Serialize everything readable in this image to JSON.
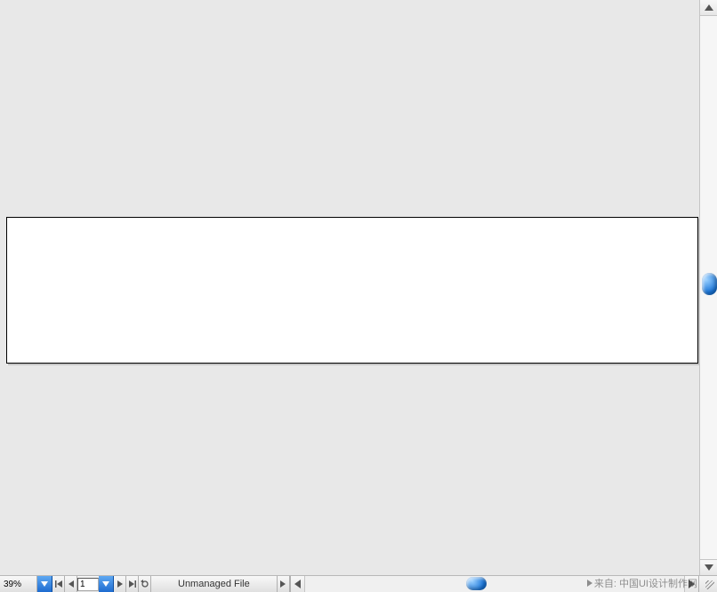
{
  "viewport": {
    "zoom": "39%"
  },
  "pagination": {
    "current_page": "1"
  },
  "status": {
    "file_state": "Unmanaged File"
  },
  "watermark": {
    "text": "来自: 中国UI设计制作网"
  }
}
